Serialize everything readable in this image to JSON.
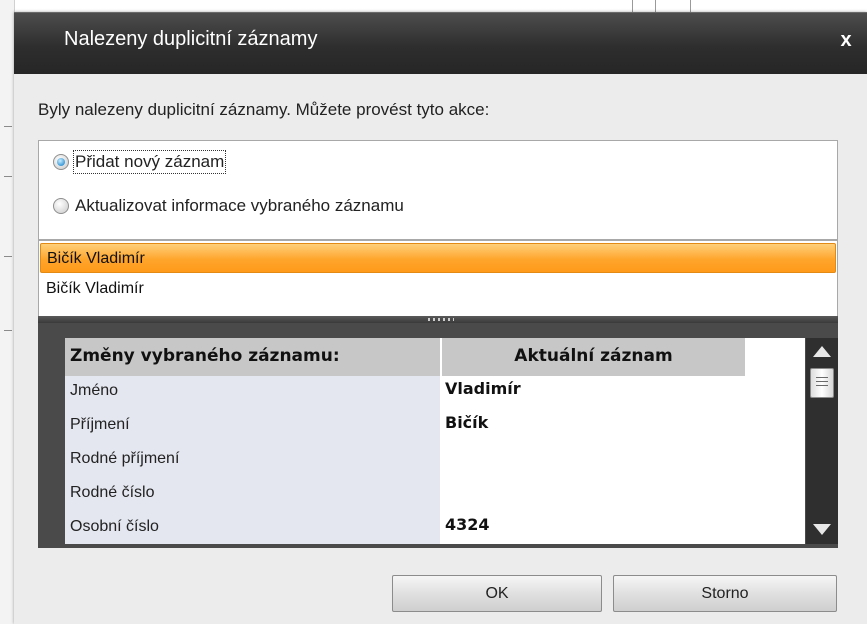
{
  "dialog": {
    "title": "Nalezeny duplicitní záznamy",
    "close_label": "x",
    "prompt": "Byly nalezeny duplicitní záznamy. Můžete provést tyto akce:"
  },
  "options": [
    {
      "label": "Přidat nový záznam",
      "checked": true
    },
    {
      "label": "Aktualizovat informace vybraného záznamu",
      "checked": false
    }
  ],
  "records": [
    {
      "name": "Bičík Vladimír",
      "selected": true
    },
    {
      "name": "Bičík Vladimír",
      "selected": false
    }
  ],
  "changes_table": {
    "header_left": "Změny vybraného záznamu:",
    "header_right": "Aktuální záznam",
    "rows": [
      {
        "label": "Jméno",
        "value": "Vladimír"
      },
      {
        "label": "Příjmení",
        "value": "Bičík"
      },
      {
        "label": "Rodné příjmení",
        "value": ""
      },
      {
        "label": "Rodné číslo",
        "value": ""
      },
      {
        "label": "Osobní číslo",
        "value": "4324"
      }
    ]
  },
  "buttons": {
    "ok": "OK",
    "cancel": "Storno"
  },
  "colors": {
    "selection_orange": "#ffa52c",
    "titlebar_dark": "#2e2e2e",
    "panel_dark": "#4a4a4a"
  }
}
